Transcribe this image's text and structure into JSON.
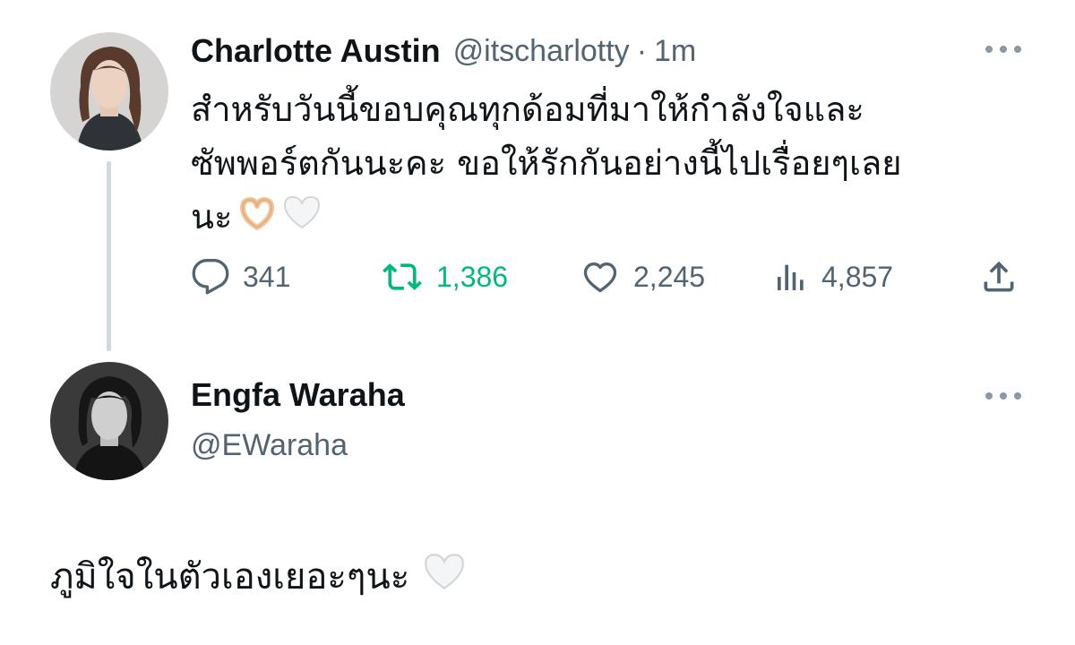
{
  "tweet": {
    "display_name": "Charlotte Austin",
    "handle": "@itscharlotty",
    "separator": "·",
    "time": "1m",
    "text_lines": [
      "สำหรับวันนี้ขอบคุณทุกด้อมที่มาให้กำลังใจและ",
      "ซัพพอร์ตกันนะคะ ขอให้รักกันอย่างนี้ไปเรื่อยๆเลย",
      "นะ"
    ],
    "emojis": [
      "heart-hands-emoji",
      "white-heart-emoji"
    ],
    "stats": {
      "replies": "341",
      "retweets": "1,386",
      "likes": "2,245",
      "views": "4,857"
    },
    "retweet_color": "#00ba7c"
  },
  "reply": {
    "display_name": "Engfa Waraha",
    "handle": "@EWaraha",
    "text": "ภูมิใจในตัวเองเยอะๆนะ",
    "emoji": "white-heart-emoji"
  },
  "colors": {
    "text_primary": "#0f1419",
    "text_secondary": "#536471",
    "thread_line": "#cfd9de"
  }
}
